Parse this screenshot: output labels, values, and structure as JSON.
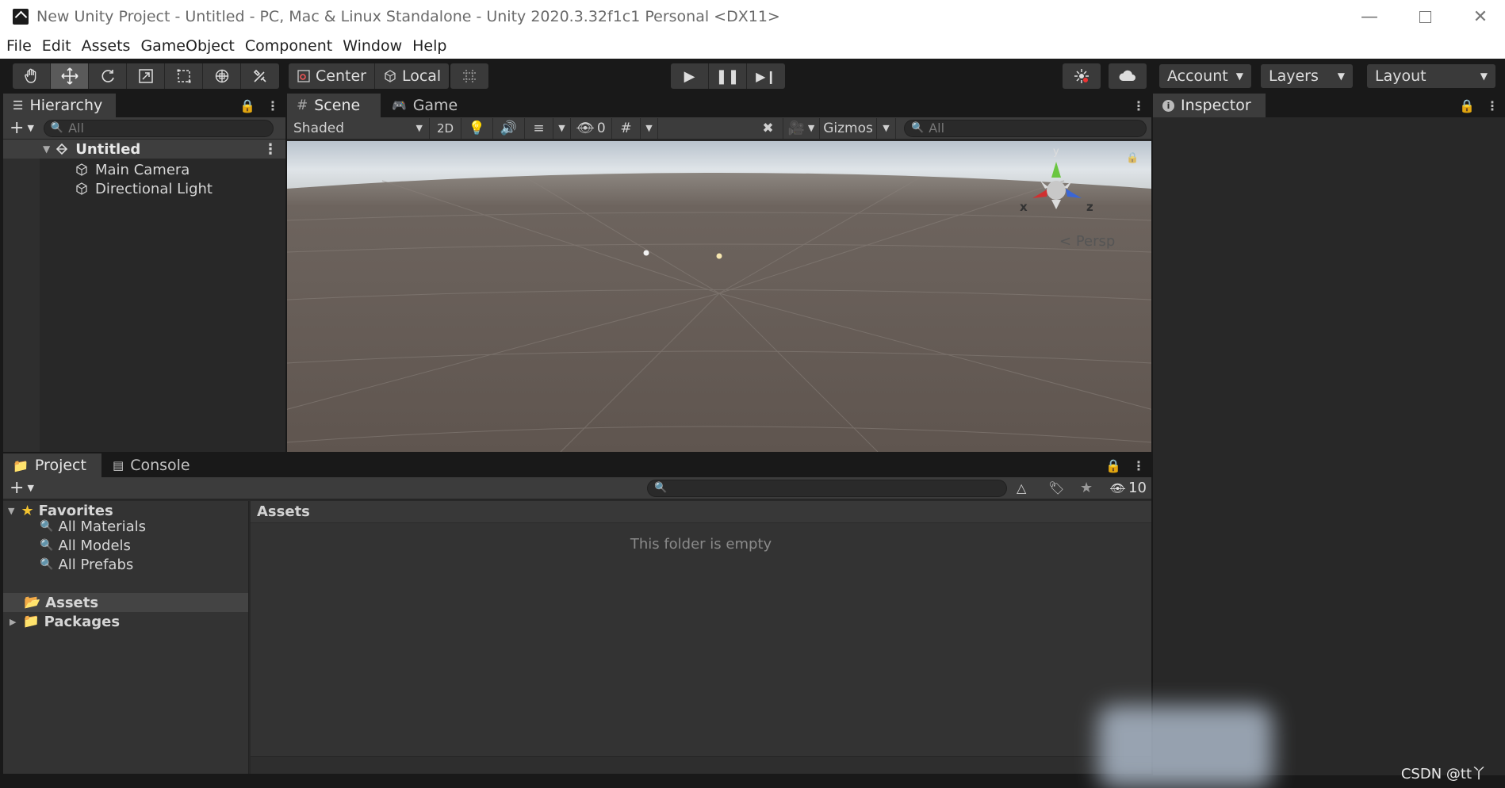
{
  "window": {
    "title": "New Unity Project - Untitled - PC, Mac & Linux Standalone - Unity 2020.3.32f1c1 Personal <DX11>"
  },
  "menu": [
    "File",
    "Edit",
    "Assets",
    "GameObject",
    "Component",
    "Window",
    "Help"
  ],
  "toolbar": {
    "tools": [
      "hand-tool-icon",
      "move-tool-icon",
      "rotate-tool-icon",
      "scale-tool-icon",
      "rect-tool-icon",
      "transform-tool-icon",
      "custom-tool-icon"
    ],
    "active_tool": "move-tool-icon",
    "pivot_label": "Center",
    "space_label": "Local",
    "account_label": "Account",
    "layers_label": "Layers",
    "layout_label": "Layout"
  },
  "hierarchy": {
    "tab_label": "Hierarchy",
    "search_placeholder": "All",
    "scene_name": "Untitled",
    "objects": [
      "Main Camera",
      "Directional Light"
    ]
  },
  "scene": {
    "tabs": [
      "Scene",
      "Game"
    ],
    "shading_mode": "Shaded",
    "mode_2d_label": "2D",
    "hidden_count": "0",
    "gizmos_label": "Gizmos",
    "search_placeholder": "All",
    "projection_label": "Persp",
    "axes": {
      "x": "x",
      "y": "y",
      "z": "z"
    }
  },
  "inspector": {
    "tab_label": "Inspector"
  },
  "project": {
    "tabs": [
      "Project",
      "Console"
    ],
    "favorites_label": "Favorites",
    "favorites": [
      "All Materials",
      "All Models",
      "All Prefabs"
    ],
    "folders": [
      "Assets",
      "Packages"
    ],
    "breadcrumb": "Assets",
    "empty_message": "This folder is empty",
    "hidden_count": "10"
  },
  "watermark": "CSDN @tt丫",
  "colors": {
    "chrome": "#191919",
    "panel": "#282828",
    "sky": "#cfd7de",
    "ground": "#6a615b"
  }
}
